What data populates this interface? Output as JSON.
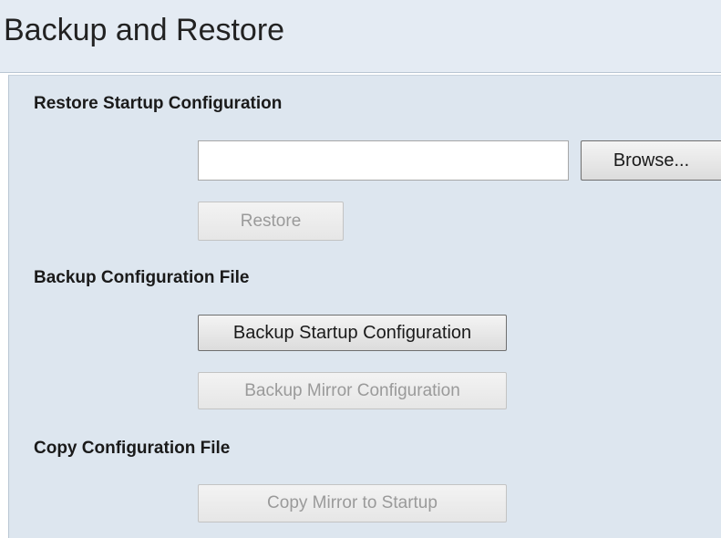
{
  "page": {
    "title": "Backup and Restore"
  },
  "restore": {
    "section_title": "Restore Startup Configuration",
    "file_input_value": "",
    "browse_label": "Browse...",
    "restore_label": "Restore"
  },
  "backup": {
    "section_title": "Backup Configuration File",
    "startup_label": "Backup Startup Configuration",
    "mirror_label": "Backup Mirror Configuration"
  },
  "copy": {
    "section_title": "Copy Configuration File",
    "mirror_to_startup_label": "Copy Mirror to Startup"
  },
  "colors": {
    "header_background": "#e4ebf3",
    "panel_background": "#dde6ef",
    "disabled_text": "#9a9a9a"
  }
}
